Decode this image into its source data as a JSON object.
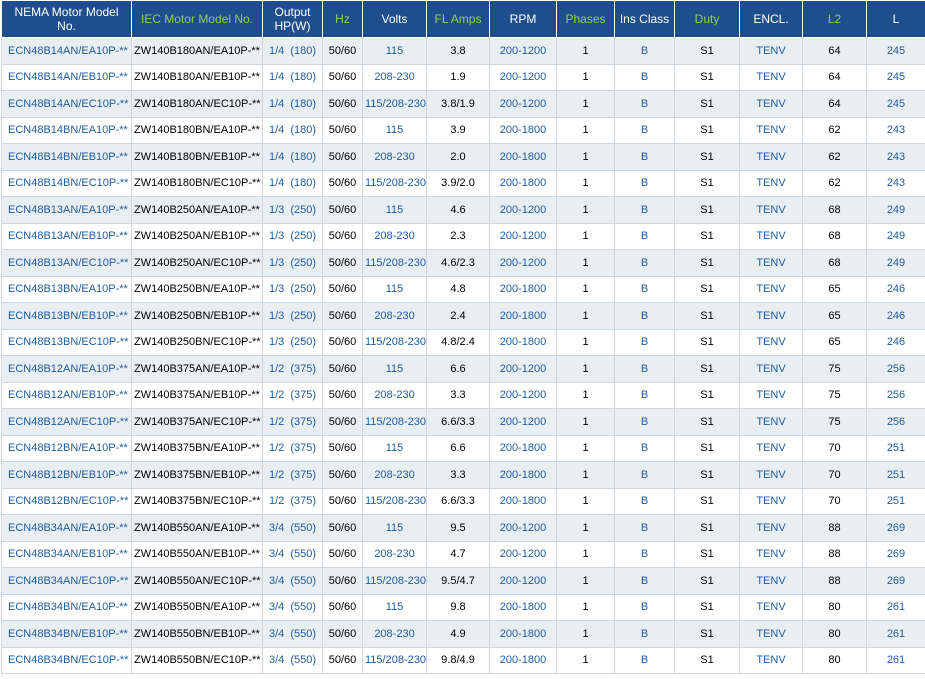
{
  "headers": [
    {
      "label": "NEMA Motor Model No.",
      "green": false
    },
    {
      "label": "IEC Motor Model No.",
      "green": true
    },
    {
      "label": "Output\nHP(W)",
      "green": false
    },
    {
      "label": "Hz",
      "green": true
    },
    {
      "label": "Volts",
      "green": false
    },
    {
      "label": "FL Amps",
      "green": true
    },
    {
      "label": "RPM",
      "green": false
    },
    {
      "label": "Phases",
      "green": true
    },
    {
      "label": "Ins Class",
      "green": false
    },
    {
      "label": "Duty",
      "green": true
    },
    {
      "label": "ENCL.",
      "green": false
    },
    {
      "label": "L2",
      "green": true
    },
    {
      "label": "L",
      "green": false
    }
  ],
  "rows": [
    [
      "ECN48B14AN/EA10P-**",
      "ZW140B180AN/EA10P-**",
      "1/4  (180)",
      "50/60",
      "115",
      "3.8",
      "200-1200",
      "1",
      "B",
      "S1",
      "TENV",
      "64",
      "245"
    ],
    [
      "ECN48B14AN/EB10P-**",
      "ZW140B180AN/EB10P-**",
      "1/4  (180)",
      "50/60",
      "208-230",
      "1.9",
      "200-1200",
      "1",
      "B",
      "S1",
      "TENV",
      "64",
      "245"
    ],
    [
      "ECN48B14AN/EC10P-**",
      "ZW140B180AN/EC10P-**",
      "1/4  (180)",
      "50/60",
      "115/208-230",
      "3.8/1.9",
      "200-1200",
      "1",
      "B",
      "S1",
      "TENV",
      "64",
      "245"
    ],
    [
      "ECN48B14BN/EA10P-**",
      "ZW140B180BN/EA10P-**",
      "1/4  (180)",
      "50/60",
      "115",
      "3.9",
      "200-1800",
      "1",
      "B",
      "S1",
      "TENV",
      "62",
      "243"
    ],
    [
      "ECN48B14BN/EB10P-**",
      "ZW140B180BN/EB10P-**",
      "1/4  (180)",
      "50/60",
      "208-230",
      "2.0",
      "200-1800",
      "1",
      "B",
      "S1",
      "TENV",
      "62",
      "243"
    ],
    [
      "ECN48B14BN/EC10P-**",
      "ZW140B180BN/EC10P-**",
      "1/4  (180)",
      "50/60",
      "115/208-230",
      "3.9/2.0",
      "200-1800",
      "1",
      "B",
      "S1",
      "TENV",
      "62",
      "243"
    ],
    [
      "ECN48B13AN/EA10P-**",
      "ZW140B250AN/EA10P-**",
      "1/3  (250)",
      "50/60",
      "115",
      "4.6",
      "200-1200",
      "1",
      "B",
      "S1",
      "TENV",
      "68",
      "249"
    ],
    [
      "ECN48B13AN/EB10P-**",
      "ZW140B250AN/EB10P-**",
      "1/3  (250)",
      "50/60",
      "208-230",
      "2.3",
      "200-1200",
      "1",
      "B",
      "S1",
      "TENV",
      "68",
      "249"
    ],
    [
      "ECN48B13AN/EC10P-**",
      "ZW140B250AN/EC10P-**",
      "1/3  (250)",
      "50/60",
      "115/208-230",
      "4.6/2.3",
      "200-1200",
      "1",
      "B",
      "S1",
      "TENV",
      "68",
      "249"
    ],
    [
      "ECN48B13BN/EA10P-**",
      "ZW140B250BN/EA10P-**",
      "1/3  (250)",
      "50/60",
      "115",
      "4.8",
      "200-1800",
      "1",
      "B",
      "S1",
      "TENV",
      "65",
      "246"
    ],
    [
      "ECN48B13BN/EB10P-**",
      "ZW140B250BN/EB10P-**",
      "1/3  (250)",
      "50/60",
      "208-230",
      "2.4",
      "200-1800",
      "1",
      "B",
      "S1",
      "TENV",
      "65",
      "246"
    ],
    [
      "ECN48B13BN/EC10P-**",
      "ZW140B250BN/EC10P-**",
      "1/3  (250)",
      "50/60",
      "115/208-230",
      "4.8/2.4",
      "200-1800",
      "1",
      "B",
      "S1",
      "TENV",
      "65",
      "246"
    ],
    [
      "ECN48B12AN/EA10P-**",
      "ZW140B375AN/EA10P-**",
      "1/2  (375)",
      "50/60",
      "115",
      "6.6",
      "200-1200",
      "1",
      "B",
      "S1",
      "TENV",
      "75",
      "256"
    ],
    [
      "ECN48B12AN/EB10P-**",
      "ZW140B375AN/EB10P-**",
      "1/2  (375)",
      "50/60",
      "208-230",
      "3.3",
      "200-1200",
      "1",
      "B",
      "S1",
      "TENV",
      "75",
      "256"
    ],
    [
      "ECN48B12AN/EC10P-**",
      "ZW140B375AN/EC10P-**",
      "1/2  (375)",
      "50/60",
      "115/208-230",
      "6.6/3.3",
      "200-1200",
      "1",
      "B",
      "S1",
      "TENV",
      "75",
      "256"
    ],
    [
      "ECN48B12BN/EA10P-**",
      "ZW140B375BN/EA10P-**",
      "1/2  (375)",
      "50/60",
      "115",
      "6.6",
      "200-1800",
      "1",
      "B",
      "S1",
      "TENV",
      "70",
      "251"
    ],
    [
      "ECN48B12BN/EB10P-**",
      "ZW140B375BN/EB10P-**",
      "1/2  (375)",
      "50/60",
      "208-230",
      "3.3",
      "200-1800",
      "1",
      "B",
      "S1",
      "TENV",
      "70",
      "251"
    ],
    [
      "ECN48B12BN/EC10P-**",
      "ZW140B375BN/EC10P-**",
      "1/2  (375)",
      "50/60",
      "115/208-230",
      "6.6/3.3",
      "200-1800",
      "1",
      "B",
      "S1",
      "TENV",
      "70",
      "251"
    ],
    [
      "ECN48B34AN/EA10P-**",
      "ZW140B550AN/EA10P-**",
      "3/4  (550)",
      "50/60",
      "115",
      "9.5",
      "200-1200",
      "1",
      "B",
      "S1",
      "TENV",
      "88",
      "269"
    ],
    [
      "ECN48B34AN/EB10P-**",
      "ZW140B550AN/EB10P-**",
      "3/4  (550)",
      "50/60",
      "208-230",
      "4.7",
      "200-1200",
      "1",
      "B",
      "S1",
      "TENV",
      "88",
      "269"
    ],
    [
      "ECN48B34AN/EC10P-**",
      "ZW140B550AN/EC10P-**",
      "3/4  (550)",
      "50/60",
      "115/208-230",
      "9.5/4.7",
      "200-1200",
      "1",
      "B",
      "S1",
      "TENV",
      "88",
      "269"
    ],
    [
      "ECN48B34BN/EA10P-**",
      "ZW140B550BN/EA10P-**",
      "3/4  (550)",
      "50/60",
      "115",
      "9.8",
      "200-1800",
      "1",
      "B",
      "S1",
      "TENV",
      "80",
      "261"
    ],
    [
      "ECN48B34BN/EB10P-**",
      "ZW140B550BN/EB10P-**",
      "3/4  (550)",
      "50/60",
      "208-230",
      "4.9",
      "200-1800",
      "1",
      "B",
      "S1",
      "TENV",
      "80",
      "261"
    ],
    [
      "ECN48B34BN/EC10P-**",
      "ZW140B550BN/EC10P-**",
      "3/4  (550)",
      "50/60",
      "115/208-230",
      "9.8/4.9",
      "200-1800",
      "1",
      "B",
      "S1",
      "TENV",
      "80",
      "261"
    ]
  ],
  "colors": {
    "header_bg": "#1f4e8c",
    "header_text": "#ffffff",
    "header_accent": "#8fd14f",
    "link_blue": "#1f5c9e",
    "row_alt": "#e9eef3"
  }
}
